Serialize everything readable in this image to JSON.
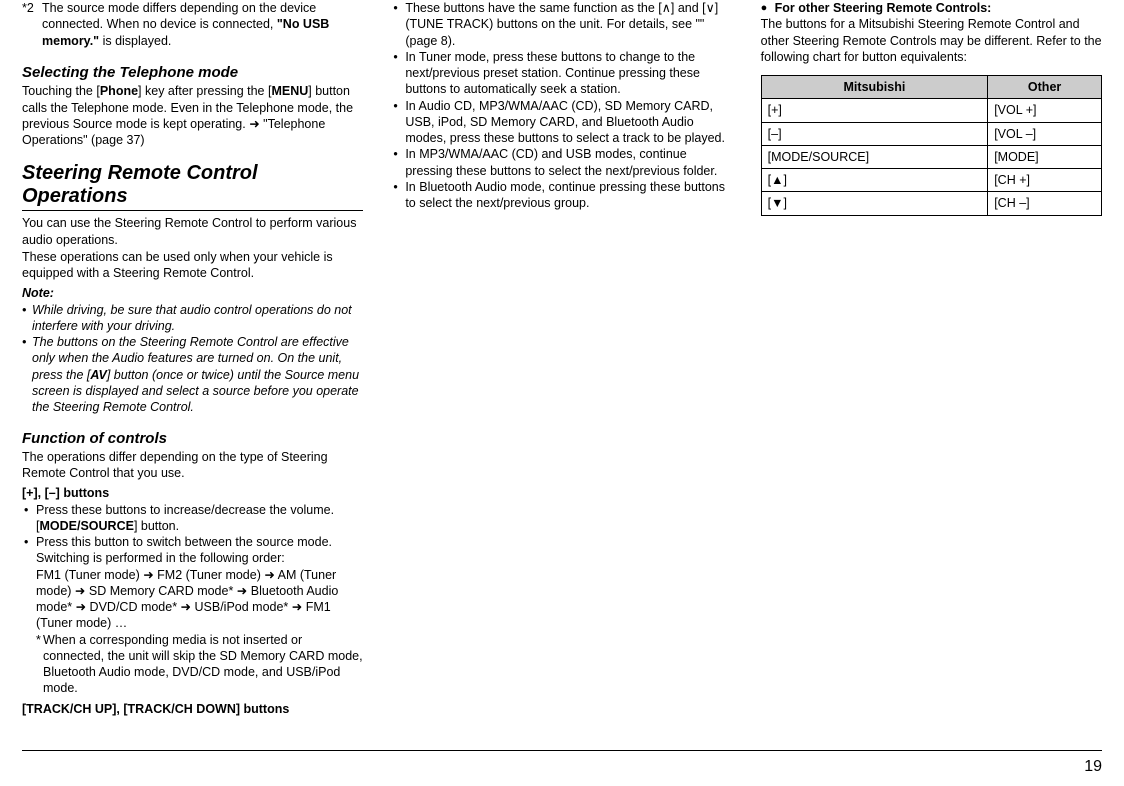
{
  "footnote2_label": "*2",
  "footnote2": "The source mode differs depending on the device connected. When no device is connected, ",
  "footnote2_bold": "\"No USB memory.\"",
  "footnote2_tail": " is displayed.",
  "sel_heading": "Selecting the Telephone mode",
  "sel_p1a": "Touching the [",
  "sel_p1b_bold": "Phone",
  "sel_p1c": "] key after pressing the [",
  "sel_p1d_bold": "MENU",
  "sel_p1e": "] button calls the Telephone mode. Even in the Telephone mode, the previous Source mode is kept operating. ➜ \"Telephone Operations\" (page 37)",
  "steer_heading": "Steering Remote Control Operations",
  "steer_p1": "You can use the Steering Remote Control to perform various audio operations.",
  "steer_p2": "These operations can be used only when your vehicle is equipped with a Steering Remote Control.",
  "note_label": "Note:",
  "note1": "While driving, be sure that audio control operations do not interfere with your driving.",
  "note2a": "The buttons on the Steering Remote Control are effective only when the Audio features are turned on. On the unit, press the [",
  "note2b_bold": "AV",
  "note2c": "] button (once or twice) until the Source menu screen is displayed and select a source before you operate the Steering Remote Control.",
  "func_heading": "Function of controls",
  "func_p1": "The operations differ depending on the type of Steering Remote Control that you use.",
  "plusminus_head": "[+], [–] buttons",
  "pm_b1a": "Press these buttons to increase/decrease the volume. [",
  "pm_b1b_bold": "MODE/SOURCE",
  "pm_b1c": "] button.",
  "pm_b2": "Press this button to switch between the source mode. Switching is performed in the following order:",
  "sequence": "FM1 (Tuner mode) ➜ FM2 (Tuner mode) ➜ AM (Tuner mode) ➜ SD Memory CARD mode* ➜ Bluetooth Audio mode* ➜ DVD/CD mode* ➜ USB/iPod mode* ➜ FM1 (Tuner mode) …",
  "star_note": "When a corresponding media is not inserted or connected, the unit will skip the SD Memory CARD mode, Bluetooth Audio mode, DVD/CD mode, and USB/iPod mode.",
  "track_head": "[TRACK/CH UP], [TRACK/CH DOWN] buttons",
  "tr_b1": "These buttons have the same function as the [∧] and [∨] (TUNE TRACK) buttons on the unit. For details, see \"\" (page 8).",
  "tr_b2": "In Tuner mode, press these buttons to change to the next/previous preset station. Continue pressing these buttons to automatically seek a station.",
  "tr_b3": "In Audio CD, MP3/WMA/AAC (CD), SD Memory CARD, USB, iPod, SD Memory CARD, and Bluetooth Audio modes, press these buttons to select a track to be played.",
  "tr_b4": "In MP3/WMA/AAC (CD) and USB modes, continue pressing these buttons to select the next/previous folder.",
  "tr_b5": "In Bluetooth Audio mode, continue pressing these buttons to select the next/previous group.",
  "other_head": "For other Steering Remote Controls:",
  "other_p": "The buttons for a Mitsubishi Steering Remote Control and other Steering Remote Controls may be different. Refer to the following chart for button equivalents:",
  "tbl": {
    "h1": "Mitsubishi",
    "h2": "Other",
    "rows": [
      {
        "m": "[+]",
        "o": "[VOL +]"
      },
      {
        "m": "[–]",
        "o": "[VOL –]"
      },
      {
        "m": "[MODE/SOURCE]",
        "o": "[MODE]"
      },
      {
        "m": "[▲]",
        "o": "[CH +]"
      },
      {
        "m": "[▼]",
        "o": "[CH –]"
      }
    ]
  },
  "page_num": "19"
}
